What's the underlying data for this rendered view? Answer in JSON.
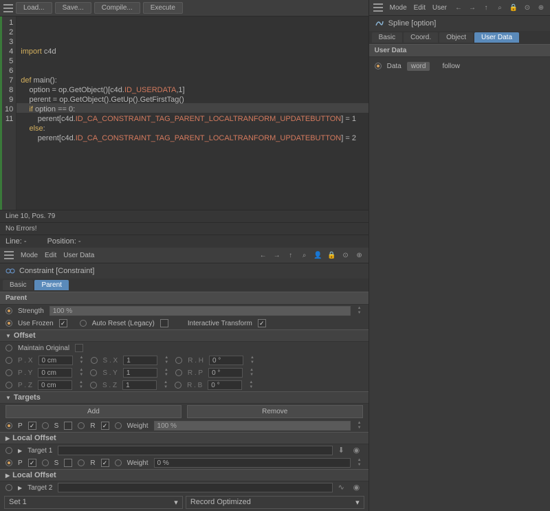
{
  "toolbar": {
    "load": "Load...",
    "save": "Save...",
    "compile": "Compile...",
    "execute": "Execute"
  },
  "code": {
    "lines": [
      {
        "n": "1",
        "html": "<span class='kw'>import</span> c4d"
      },
      {
        "n": "2",
        "html": ""
      },
      {
        "n": "3",
        "html": ""
      },
      {
        "n": "4",
        "html": "<span class='kw'>def</span> main():"
      },
      {
        "n": "5",
        "html": "    option = op.GetObject()[c4d.<span class='const'>ID_USERDATA</span>,1]"
      },
      {
        "n": "6",
        "html": "    perent = op.GetObject().GetUp().GetFirstTag()"
      },
      {
        "n": "7",
        "html": "    <span class='kw'>if</span> option == 0:"
      },
      {
        "n": "8",
        "html": "        perent[c4d.<span class='const'>ID_CA_CONSTRAINT_TAG_PARENT_LOCALTRANFORM_UPDATEBUTTON</span>] = 1"
      },
      {
        "n": "9",
        "html": "    <span class='kw'>else</span>:"
      },
      {
        "n": "10",
        "html": "        perent[c4d.<span class='const'>ID_CA_CONSTRAINT_TAG_PARENT_LOCALTRANFORM_UPDATEBUTTON</span>] = 2"
      },
      {
        "n": "11",
        "html": ""
      }
    ]
  },
  "status": {
    "pos": "Line 10, Pos. 79",
    "errors": "No Errors!",
    "line_label": "Line: -",
    "position_label": "Position: -"
  },
  "attr_menu": {
    "mode": "Mode",
    "edit": "Edit",
    "user_data": "User Data"
  },
  "constraint": {
    "title": "Constraint [Constraint]",
    "tabs": {
      "basic": "Basic",
      "parent": "Parent"
    },
    "parent_hdr": "Parent",
    "strength_label": "Strength",
    "strength_value": "100 %",
    "use_frozen": "Use Frozen",
    "auto_reset": "Auto Reset (Legacy)",
    "interactive": "Interactive Transform",
    "offset_hdr": "Offset",
    "maintain": "Maintain Original",
    "px": "P . X",
    "py": "P . Y",
    "pz": "P . Z",
    "sx": "S . X",
    "sy": "S . Y",
    "sz": "S . Z",
    "rh": "R . H",
    "rp": "R . P",
    "rb": "R . B",
    "zero_cm": "0 cm",
    "one": "1",
    "zero_deg": "0 °",
    "targets_hdr": "Targets",
    "add": "Add",
    "remove": "Remove",
    "p_label": "P",
    "s_label": "S",
    "r_label": "R",
    "weight_label": "Weight",
    "weight_100": "100 %",
    "weight_0": "0 %",
    "local_offset": "Local Offset",
    "target1": "Target   1",
    "target2": "Target   2",
    "set1": "Set 1",
    "record_opt": "Record Optimized"
  },
  "right": {
    "menu": {
      "mode": "Mode",
      "edit": "Edit",
      "user": "User"
    },
    "spline_title": "Spline [option]",
    "tabs": {
      "basic": "Basic",
      "coord": "Coord.",
      "object": "Object",
      "user_data": "User Data"
    },
    "user_data_hdr": "User Data",
    "data_label": "Data",
    "word_tag": "word",
    "follow_tag": "follow"
  }
}
